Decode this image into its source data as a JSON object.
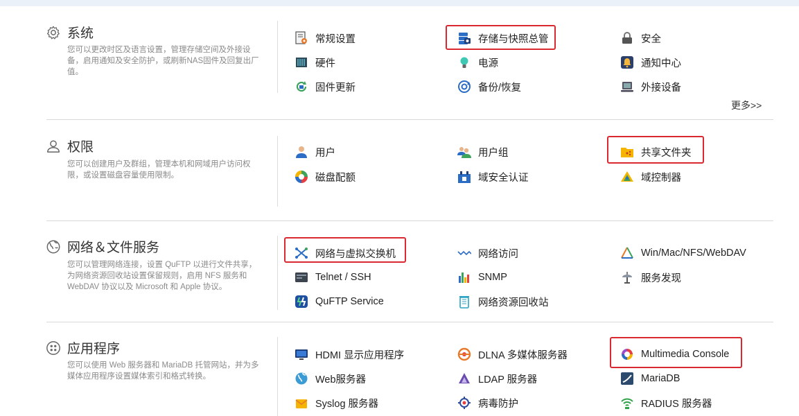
{
  "sections": {
    "system": {
      "title": "系统",
      "desc": "您可以更改时区及语言设置，管理存储空间及外接设备，启用通知及安全防护，或刷新NAS固件及回复出厂值。",
      "items": [
        "常规设置",
        "存储与快照总管",
        "安全",
        "硬件",
        "电源",
        "通知中心",
        "固件更新",
        "备份/恢复",
        "外接设备"
      ],
      "more": "更多>>"
    },
    "privilege": {
      "title": "权限",
      "desc": "您可以创建用户及群组，管理本机和网域用户访问权限，或设置磁盘容量使用限制。",
      "items": [
        "用户",
        "用户组",
        "共享文件夹",
        "磁盘配额",
        "域安全认证",
        "域控制器"
      ]
    },
    "network": {
      "title": "网络＆文件服务",
      "desc": "您可以管理网络连接，设置 QuFTP 以进行文件共享，为网络资源回收站设置保留规则，启用 NFS 服务和 WebDAV 协议以及 Microsoft 和 Apple 协议。",
      "items": [
        "网络与虚拟交换机",
        "网络访问",
        "Win/Mac/NFS/WebDAV",
        "Telnet / SSH",
        "SNMP",
        "服务发现",
        "QuFTP Service",
        "网络资源回收站"
      ]
    },
    "apps": {
      "title": "应用程序",
      "desc": "您可以使用 Web 服务器和 MariaDB 托管网站，并为多媒体应用程序设置媒体索引和格式转换。",
      "items": [
        "HDMI 显示应用程序",
        "DLNA 多媒体服务器",
        "Multimedia Console",
        "Web服务器",
        "LDAP 服务器",
        "MariaDB",
        "Syslog 服务器",
        "病毒防护",
        "RADIUS 服务器"
      ]
    }
  },
  "highlight_color": "#d9282f"
}
